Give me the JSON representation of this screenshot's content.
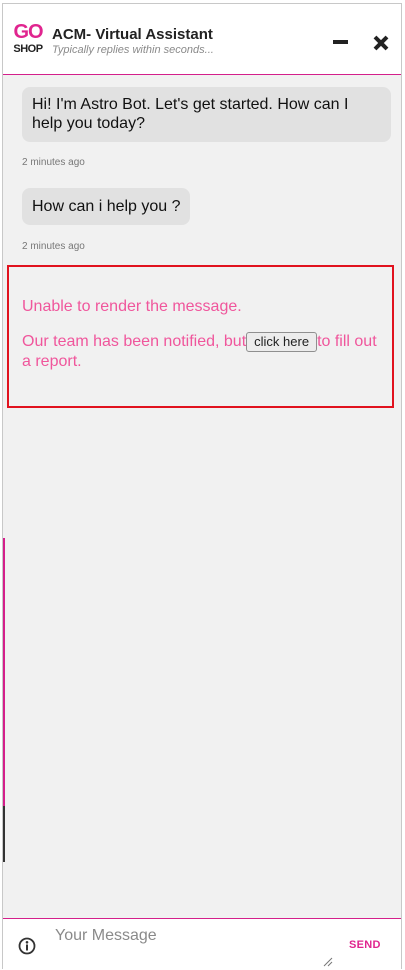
{
  "header": {
    "logo_top": "GO",
    "logo_bottom": "SHOP",
    "title": "ACM- Virtual Assistant",
    "subtitle": "Typically replies within seconds..."
  },
  "messages": [
    {
      "text": "Hi! I'm Astro Bot. Let's get started. How can I help you today?",
      "timestamp": "2 minutes ago"
    },
    {
      "text": "How can i help you ?",
      "timestamp": "2 minutes ago"
    }
  ],
  "error": {
    "line1": "Unable to render the message.",
    "line2_before": "Our team has been notified, but",
    "button_label": "click here",
    "line2_after": "to fill out a report."
  },
  "composer": {
    "placeholder": "Your Message",
    "send_label": "SEND"
  },
  "colors": {
    "brand": "#e0258f",
    "error_border": "#e1121e",
    "error_text": "#f0569c",
    "bubble": "#e1e1e1",
    "background": "#f1f1f1"
  },
  "icons": {
    "minimize": "minimize-icon",
    "close": "close-icon",
    "info": "info-icon",
    "resize": "resize-grip-icon"
  }
}
